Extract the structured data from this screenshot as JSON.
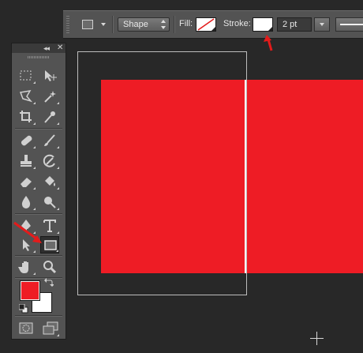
{
  "options_bar": {
    "shape_mode": "Shape",
    "fill_label": "Fill:",
    "stroke_label": "Stroke:",
    "stroke_width": "2 pt"
  },
  "colors": {
    "foreground": "#ee1c25",
    "background": "#ffffff",
    "shape_fill": "#ee1c25",
    "stroke_color": "#ffffff",
    "annotation_arrow": "#e31b1b"
  },
  "tools": [
    "rectangular-marquee",
    "move",
    "lasso",
    "magic-wand",
    "crop",
    "eyedropper",
    "spot-healing-brush",
    "brush",
    "clone-stamp",
    "history-brush",
    "eraser",
    "paint-bucket",
    "blur",
    "dodge",
    "pen",
    "type",
    "path-selection",
    "rectangle",
    "hand",
    "zoom"
  ],
  "selected_tool": "rectangle",
  "panel": {
    "collapse_label": "◂◂",
    "close_label": "✕"
  }
}
